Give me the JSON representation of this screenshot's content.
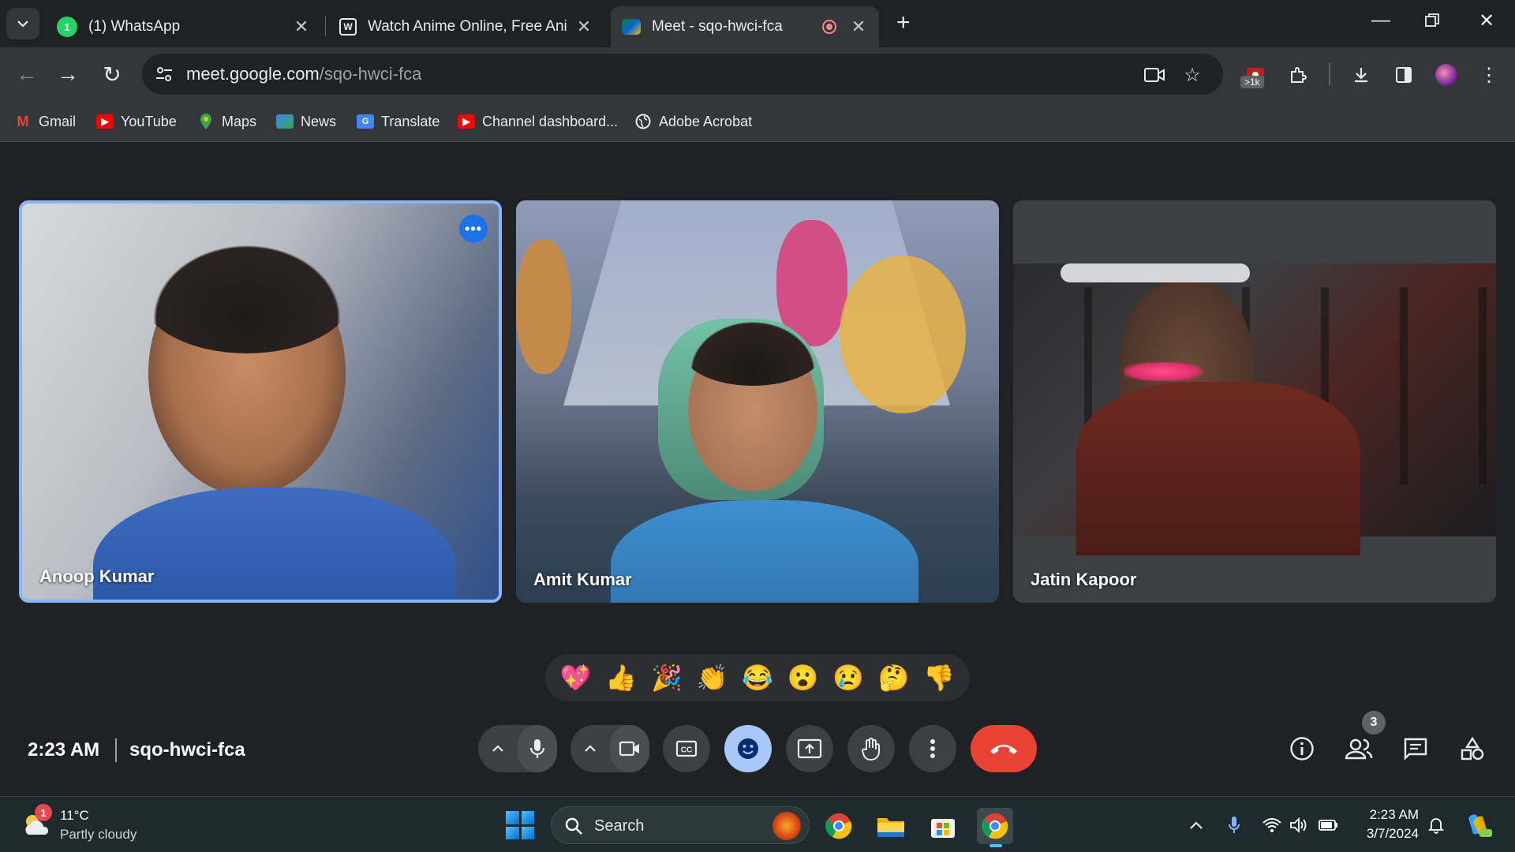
{
  "browser": {
    "tabs": [
      {
        "title": "(1) WhatsApp",
        "badge": "1"
      },
      {
        "title": "Watch Anime Online, Free Anim"
      },
      {
        "title": "Meet - sqo-hwci-fca",
        "active": true
      }
    ],
    "address": {
      "domain": "meet.google.com",
      "path": "/sqo-hwci-fca"
    },
    "extension_badge": ">1k",
    "bookmarks": [
      {
        "label": "Gmail",
        "icon": "gmail-icon"
      },
      {
        "label": "YouTube",
        "icon": "youtube-icon"
      },
      {
        "label": "Maps",
        "icon": "maps-icon"
      },
      {
        "label": "News",
        "icon": "news-icon"
      },
      {
        "label": "Translate",
        "icon": "translate-icon"
      },
      {
        "label": "Channel dashboard...",
        "icon": "youtube-icon"
      },
      {
        "label": "Adobe Acrobat",
        "icon": "globe-icon"
      }
    ]
  },
  "meet": {
    "participants": [
      {
        "name": "Anoop Kumar",
        "highlighted": true
      },
      {
        "name": "Amit Kumar"
      },
      {
        "name": "Jatin Kapoor"
      }
    ],
    "reactions": [
      "💖",
      "👍",
      "🎉",
      "👏",
      "😂",
      "😮",
      "😢",
      "🤔",
      "👎"
    ],
    "time": "2:23 AM",
    "code": "sqo-hwci-fca",
    "people_count": "3",
    "colors": {
      "accent": "#8ab4f8",
      "end_call": "#ea4335",
      "active_control": "#a8c7fa"
    }
  },
  "taskbar": {
    "weather": {
      "temp": "11°C",
      "desc": "Partly cloudy",
      "badge": "1"
    },
    "search_label": "Search",
    "clock": {
      "time": "2:23 AM",
      "date": "3/7/2024"
    }
  }
}
